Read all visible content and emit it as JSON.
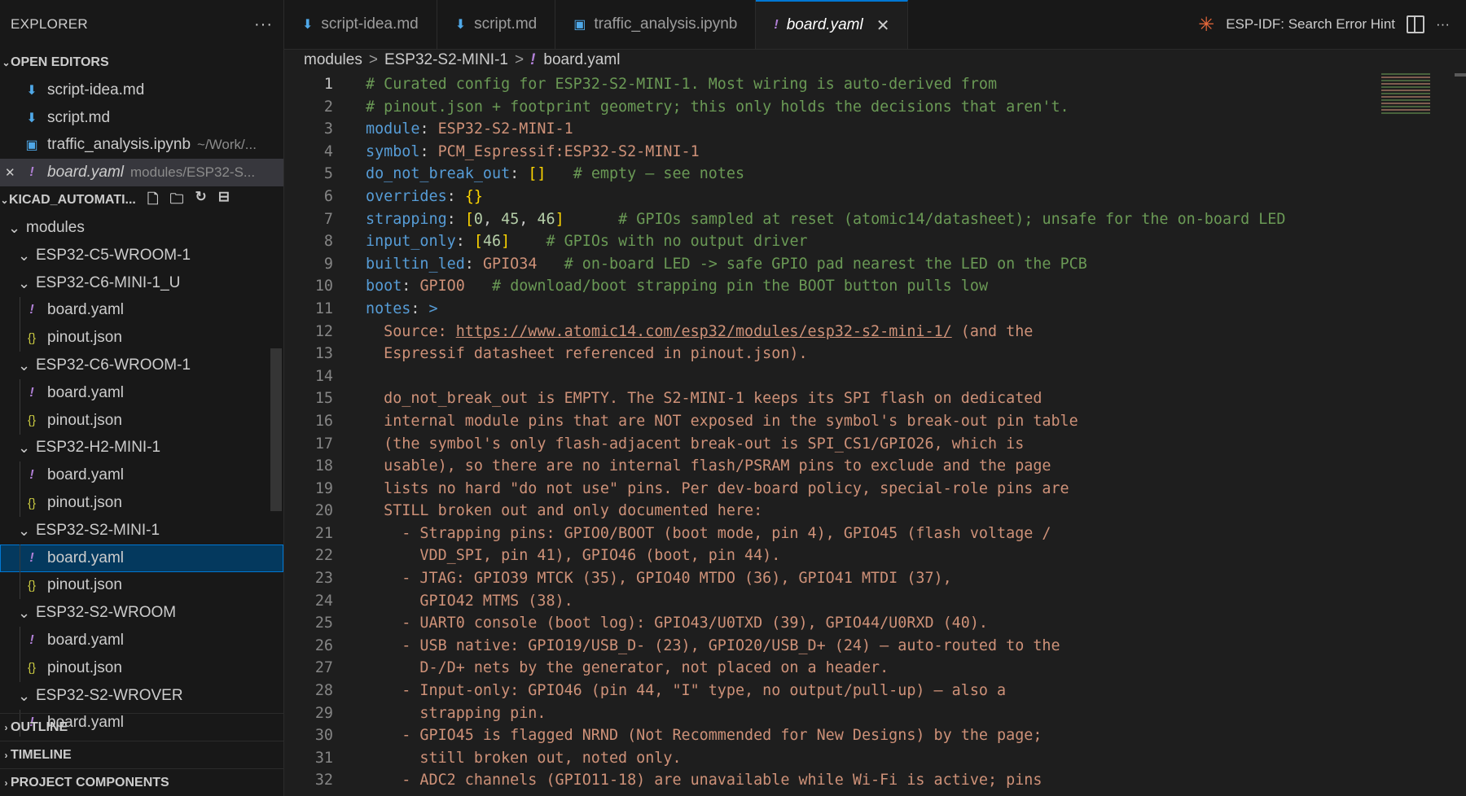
{
  "explorer": {
    "title": "EXPLORER",
    "more": "···",
    "open_editors_title": "OPEN EDITORS",
    "open_editors": [
      {
        "name": "script-idea.md",
        "desc": "",
        "icon": "markdown-file-icon",
        "italic": false,
        "close": false
      },
      {
        "name": "script.md",
        "desc": "",
        "icon": "markdown-file-icon",
        "italic": false,
        "close": false
      },
      {
        "name": "traffic_analysis.ipynb",
        "desc": "~/Work/...",
        "icon": "notebook-file-icon",
        "italic": false,
        "close": false
      },
      {
        "name": "board.yaml",
        "desc": "modules/ESP32-S...",
        "icon": "yaml-file-icon",
        "italic": true,
        "close": true
      }
    ],
    "workspace_title": "KICAD_AUTOMATI...",
    "tree": [
      {
        "depth": 0,
        "label": "modules",
        "type": "folder"
      },
      {
        "depth": 1,
        "label": "ESP32-C5-WROOM-1",
        "type": "folder"
      },
      {
        "depth": 1,
        "label": "ESP32-C6-MINI-1_U",
        "type": "folder"
      },
      {
        "depth": 2,
        "label": "board.yaml",
        "type": "yaml"
      },
      {
        "depth": 2,
        "label": "pinout.json",
        "type": "json"
      },
      {
        "depth": 1,
        "label": "ESP32-C6-WROOM-1",
        "type": "folder"
      },
      {
        "depth": 2,
        "label": "board.yaml",
        "type": "yaml"
      },
      {
        "depth": 2,
        "label": "pinout.json",
        "type": "json"
      },
      {
        "depth": 1,
        "label": "ESP32-H2-MINI-1",
        "type": "folder"
      },
      {
        "depth": 2,
        "label": "board.yaml",
        "type": "yaml"
      },
      {
        "depth": 2,
        "label": "pinout.json",
        "type": "json"
      },
      {
        "depth": 1,
        "label": "ESP32-S2-MINI-1",
        "type": "folder"
      },
      {
        "depth": 2,
        "label": "board.yaml",
        "type": "yaml",
        "selected": true
      },
      {
        "depth": 2,
        "label": "pinout.json",
        "type": "json"
      },
      {
        "depth": 1,
        "label": "ESP32-S2-WROOM",
        "type": "folder"
      },
      {
        "depth": 2,
        "label": "board.yaml",
        "type": "yaml"
      },
      {
        "depth": 2,
        "label": "pinout.json",
        "type": "json"
      },
      {
        "depth": 1,
        "label": "ESP32-S2-WROVER",
        "type": "folder"
      },
      {
        "depth": 2,
        "label": "board.yaml",
        "type": "yaml"
      }
    ],
    "bottom_sections": [
      "OUTLINE",
      "TIMELINE",
      "PROJECT COMPONENTS"
    ]
  },
  "tabs": [
    {
      "label": "script-idea.md",
      "icon": "markdown-file-icon",
      "active": false
    },
    {
      "label": "script.md",
      "icon": "markdown-file-icon",
      "active": false
    },
    {
      "label": "traffic_analysis.ipynb",
      "icon": "notebook-file-icon",
      "active": false
    },
    {
      "label": "board.yaml",
      "icon": "yaml-file-icon",
      "active": true
    }
  ],
  "tab_actions": {
    "esp_idf_label": "ESP-IDF: Search Error Hint",
    "more": "···"
  },
  "breadcrumb": [
    "modules",
    "ESP32-S2-MINI-1",
    "board.yaml"
  ],
  "editor": {
    "current_line": 1,
    "lines": [
      [
        [
          "c",
          "# Curated config for ESP32-S2-MINI-1. Most wiring is auto-derived from"
        ]
      ],
      [
        [
          "c",
          "# pinout.json + footprint geometry; this only holds the decisions that aren't."
        ]
      ],
      [
        [
          "k",
          "module"
        ],
        [
          "p",
          ": "
        ],
        [
          "s",
          "ESP32-S2-MINI-1"
        ]
      ],
      [
        [
          "k",
          "symbol"
        ],
        [
          "p",
          ": "
        ],
        [
          "s",
          "PCM_Espressif:ESP32-S2-MINI-1"
        ]
      ],
      [
        [
          "k",
          "do_not_break_out"
        ],
        [
          "p",
          ": "
        ],
        [
          "b",
          "[]"
        ],
        [
          "p",
          "   "
        ],
        [
          "c",
          "# empty — see notes"
        ]
      ],
      [
        [
          "k",
          "overrides"
        ],
        [
          "p",
          ": "
        ],
        [
          "b",
          "{}"
        ]
      ],
      [
        [
          "k",
          "strapping"
        ],
        [
          "p",
          ": "
        ],
        [
          "b",
          "["
        ],
        [
          "n",
          "0"
        ],
        [
          "p",
          ", "
        ],
        [
          "n",
          "45"
        ],
        [
          "p",
          ", "
        ],
        [
          "n",
          "46"
        ],
        [
          "b",
          "]"
        ],
        [
          "p",
          "      "
        ],
        [
          "c",
          "# GPIOs sampled at reset (atomic14/datasheet); unsafe for the on-board LED"
        ]
      ],
      [
        [
          "k",
          "input_only"
        ],
        [
          "p",
          ": "
        ],
        [
          "b",
          "["
        ],
        [
          "n",
          "46"
        ],
        [
          "b",
          "]"
        ],
        [
          "p",
          "    "
        ],
        [
          "c",
          "# GPIOs with no output driver"
        ]
      ],
      [
        [
          "k",
          "builtin_led"
        ],
        [
          "p",
          ": "
        ],
        [
          "s",
          "GPIO34"
        ],
        [
          "p",
          "   "
        ],
        [
          "c",
          "# on-board LED -> safe GPIO pad nearest the LED on the PCB"
        ]
      ],
      [
        [
          "k",
          "boot"
        ],
        [
          "p",
          ": "
        ],
        [
          "s",
          "GPIO0"
        ],
        [
          "p",
          "   "
        ],
        [
          "c",
          "# download/boot strapping pin the BOOT button pulls low"
        ]
      ],
      [
        [
          "k",
          "notes"
        ],
        [
          "p",
          ": "
        ],
        [
          "k",
          ">"
        ]
      ],
      [
        [
          "s",
          "  Source: "
        ],
        [
          "u",
          "https://www.atomic14.com/esp32/modules/esp32-s2-mini-1/"
        ],
        [
          "s",
          " (and the"
        ]
      ],
      [
        [
          "s",
          "  Espressif datasheet referenced in pinout.json)."
        ]
      ],
      [
        [
          "s",
          ""
        ]
      ],
      [
        [
          "s",
          "  do_not_break_out is EMPTY. The S2-MINI-1 keeps its SPI flash on dedicated"
        ]
      ],
      [
        [
          "s",
          "  internal module pins that are NOT exposed in the symbol's break-out pin table"
        ]
      ],
      [
        [
          "s",
          "  (the symbol's only flash-adjacent break-out is SPI_CS1/GPIO26, which is"
        ]
      ],
      [
        [
          "s",
          "  usable), so there are no internal flash/PSRAM pins to exclude and the page"
        ]
      ],
      [
        [
          "s",
          "  lists no hard \"do not use\" pins. Per dev-board policy, special-role pins are"
        ]
      ],
      [
        [
          "s",
          "  STILL broken out and only documented here:"
        ]
      ],
      [
        [
          "s",
          "    - Strapping pins: GPIO0/BOOT (boot mode, pin 4), GPIO45 (flash voltage /"
        ]
      ],
      [
        [
          "s",
          "      VDD_SPI, pin 41), GPIO46 (boot, pin 44)."
        ]
      ],
      [
        [
          "s",
          "    - JTAG: GPIO39 MTCK (35), GPIO40 MTDO (36), GPIO41 MTDI (37),"
        ]
      ],
      [
        [
          "s",
          "      GPIO42 MTMS (38)."
        ]
      ],
      [
        [
          "s",
          "    - UART0 console (boot log): GPIO43/U0TXD (39), GPIO44/U0RXD (40)."
        ]
      ],
      [
        [
          "s",
          "    - USB native: GPIO19/USB_D- (23), GPIO20/USB_D+ (24) — auto-routed to the"
        ]
      ],
      [
        [
          "s",
          "      D-/D+ nets by the generator, not placed on a header."
        ]
      ],
      [
        [
          "s",
          "    - Input-only: GPIO46 (pin 44, \"I\" type, no output/pull-up) — also a"
        ]
      ],
      [
        [
          "s",
          "      strapping pin."
        ]
      ],
      [
        [
          "s",
          "    - GPIO45 is flagged NRND (Not Recommended for New Designs) by the page;"
        ]
      ],
      [
        [
          "s",
          "      still broken out, noted only."
        ]
      ],
      [
        [
          "s",
          "    - ADC2 channels (GPIO11-18) are unavailable while Wi-Fi is active; pins"
        ]
      ]
    ]
  }
}
